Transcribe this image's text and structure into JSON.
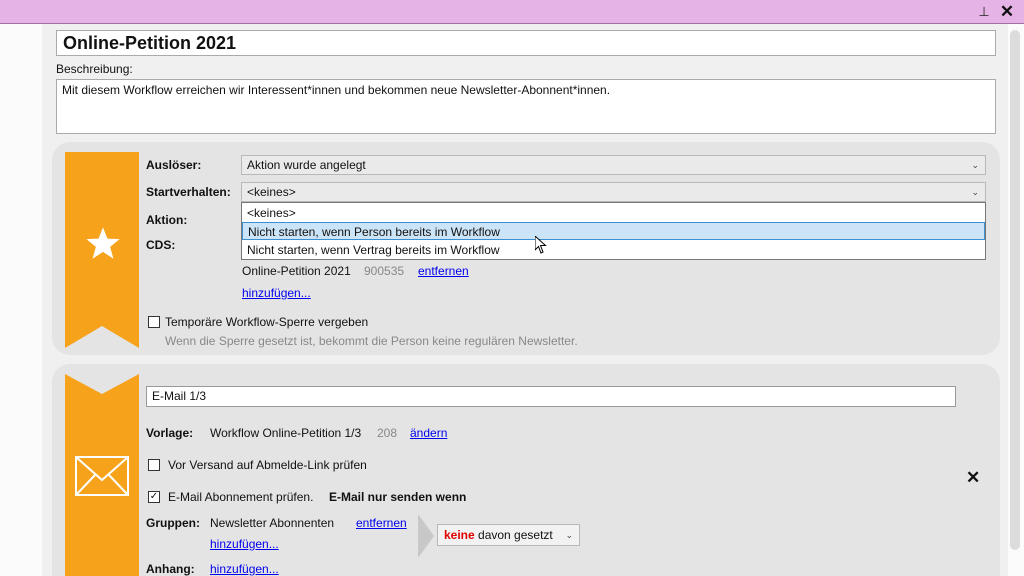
{
  "window": {
    "pin_glyph": "⊥",
    "close_glyph": "✕"
  },
  "form": {
    "title": "Online-Petition 2021",
    "description_label": "Beschreibung:",
    "description": "Mit diesem Workflow erreichen wir Interessent*innen und bekommen neue Newsletter-Abonnent*innen."
  },
  "trigger": {
    "ausloeser_label": "Auslöser:",
    "ausloeser_value": "Aktion wurde angelegt",
    "start_label": "Startverhalten:",
    "start_value": "<keines>",
    "start_options": [
      "<keines>",
      "Nicht starten, wenn Person bereits im Workflow",
      "Nicht starten, wenn Vertrag bereits im Workflow"
    ],
    "start_selected_index": 1,
    "aktion_label": "Aktion:",
    "cds_label": "CDS:",
    "item_name": "Online-Petition 2021",
    "item_id": "900535",
    "remove_link": "entfernen",
    "add_link": "hinzufügen...",
    "lock_label": "Temporäre Workflow-Sperre vergeben",
    "lock_checked": false,
    "lock_hint": "Wenn die Sperre gesetzt ist, bekommt die Person keine regulären Newsletter."
  },
  "email_step": {
    "name": "E-Mail 1/3",
    "vorlage_label": "Vorlage:",
    "vorlage_value": "Workflow Online-Petition 1/3",
    "vorlage_id": "208",
    "change_link": "ändern",
    "unsubscribe_check_label": "Vor Versand auf Abmelde-Link prüfen",
    "unsubscribe_checked": false,
    "subscription_check_label": "E-Mail Abonnement prüfen.",
    "subscription_checked": true,
    "send_only_if": "E-Mail nur senden wenn",
    "gruppen_label": "Gruppen:",
    "group_name": "Newsletter Abonnenten",
    "group_remove_link": "entfernen",
    "group_add_link": "hinzufügen...",
    "condition_keyword": "keine",
    "condition_rest": " davon gesetzt",
    "anhang_label": "Anhang:",
    "anhang_add_link": "hinzufügen...",
    "remove_glyph": "✕"
  },
  "colors": {
    "accent": "#f7a21b",
    "titlebar": "#e6b3e6",
    "selected_option": "#cce4f7",
    "link": "#0000ee"
  }
}
